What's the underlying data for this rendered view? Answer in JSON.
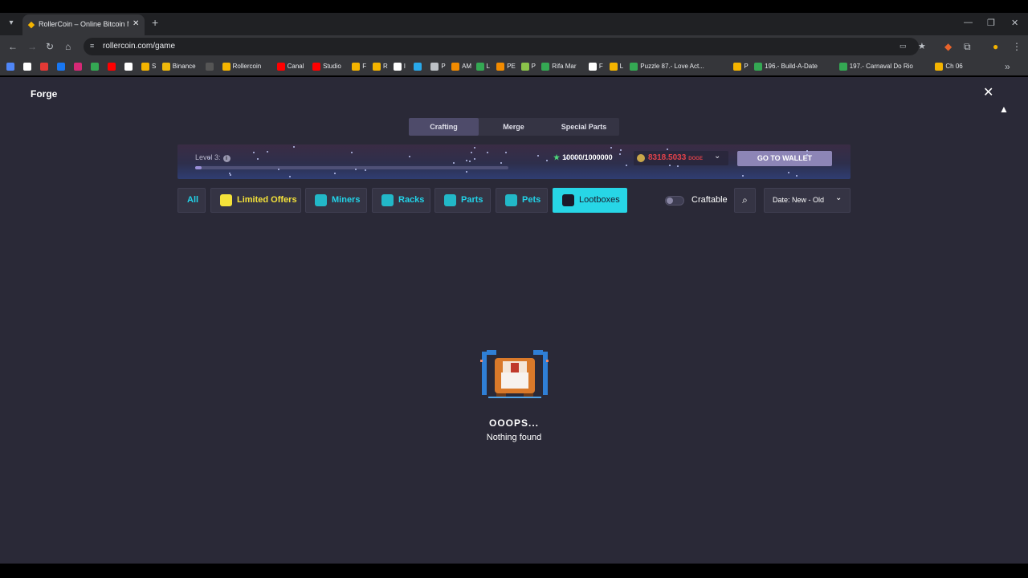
{
  "browser": {
    "tab_title": "RollerCoin – Online Bitcoin Mi",
    "url": "rollercoin.com/game",
    "bookmarks": [
      {
        "label": "",
        "color": "#4f86f7"
      },
      {
        "label": "",
        "color": "#ffffff"
      },
      {
        "label": "",
        "color": "#e53935"
      },
      {
        "label": "",
        "color": "#1877f2"
      },
      {
        "label": "",
        "color": "#d62976"
      },
      {
        "label": "",
        "color": "#34a853"
      },
      {
        "label": "",
        "color": "#ff0000"
      },
      {
        "label": "",
        "color": "#ffffff"
      },
      {
        "label": "S",
        "color": "#f4b400"
      },
      {
        "label": "Binance",
        "color": "#f0b90b"
      },
      {
        "label": "",
        "color": "#555555"
      },
      {
        "label": "Rollercoin",
        "color": "#f4b400"
      },
      {
        "label": "Canal",
        "color": "#ff0000"
      },
      {
        "label": "Studio",
        "color": "#ff0000"
      },
      {
        "label": "F",
        "color": "#f4b400"
      },
      {
        "label": "R",
        "color": "#f4b400"
      },
      {
        "label": "I",
        "color": "#ffffff"
      },
      {
        "label": "",
        "color": "#29a9eb"
      },
      {
        "label": "P",
        "color": "#bdc1c6"
      },
      {
        "label": "AM",
        "color": "#f28b00"
      },
      {
        "label": "L",
        "color": "#34a853"
      },
      {
        "label": "PE",
        "color": "#f28b00"
      },
      {
        "label": "P",
        "color": "#8bc34a"
      },
      {
        "label": "Rifa Mar",
        "color": "#34a853"
      },
      {
        "label": "F",
        "color": "#ffffff"
      },
      {
        "label": "L",
        "color": "#f4b400"
      },
      {
        "label": "Puzzle 87.- Love Act...",
        "color": "#34a853"
      },
      {
        "label": "P",
        "color": "#f4b400"
      },
      {
        "label": "196.- Build-A-Date",
        "color": "#34a853"
      },
      {
        "label": "197.- Carnaval Do Rio",
        "color": "#34a853"
      },
      {
        "label": "Ch 06",
        "color": "#f4b400"
      }
    ]
  },
  "page": {
    "title": "Forge"
  },
  "tabs": [
    {
      "label": "Crafting",
      "active": true
    },
    {
      "label": "Merge",
      "active": false
    },
    {
      "label": "Special Parts",
      "active": false
    }
  ],
  "level": {
    "label": "Level 3:",
    "progress": 0.01,
    "xp": "10000/1000000"
  },
  "balance": {
    "value": "8318.5033",
    "currency": "DOGE"
  },
  "wallet_button": "GO TO WALLET",
  "filters": [
    {
      "label": "All",
      "icon": "none"
    },
    {
      "label": "Limited Offers",
      "icon": "gift-hand-icon"
    },
    {
      "label": "Miners",
      "icon": "miner-icon"
    },
    {
      "label": "Racks",
      "icon": "rack-icon"
    },
    {
      "label": "Parts",
      "icon": "parts-icon"
    },
    {
      "label": "Pets",
      "icon": "pet-icon"
    },
    {
      "label": "Lootboxes",
      "icon": "lootbox-icon",
      "active": true
    }
  ],
  "craftable": {
    "label": "Craftable",
    "enabled": false
  },
  "sort": {
    "label": "Date: New - Old"
  },
  "empty_state": {
    "title": "OOOPS...",
    "subtitle": "Nothing found"
  },
  "colors": {
    "accent": "#27d6e6",
    "page_bg": "#2a2937",
    "balance": "#e2424a",
    "limited": "#f4e23a"
  }
}
